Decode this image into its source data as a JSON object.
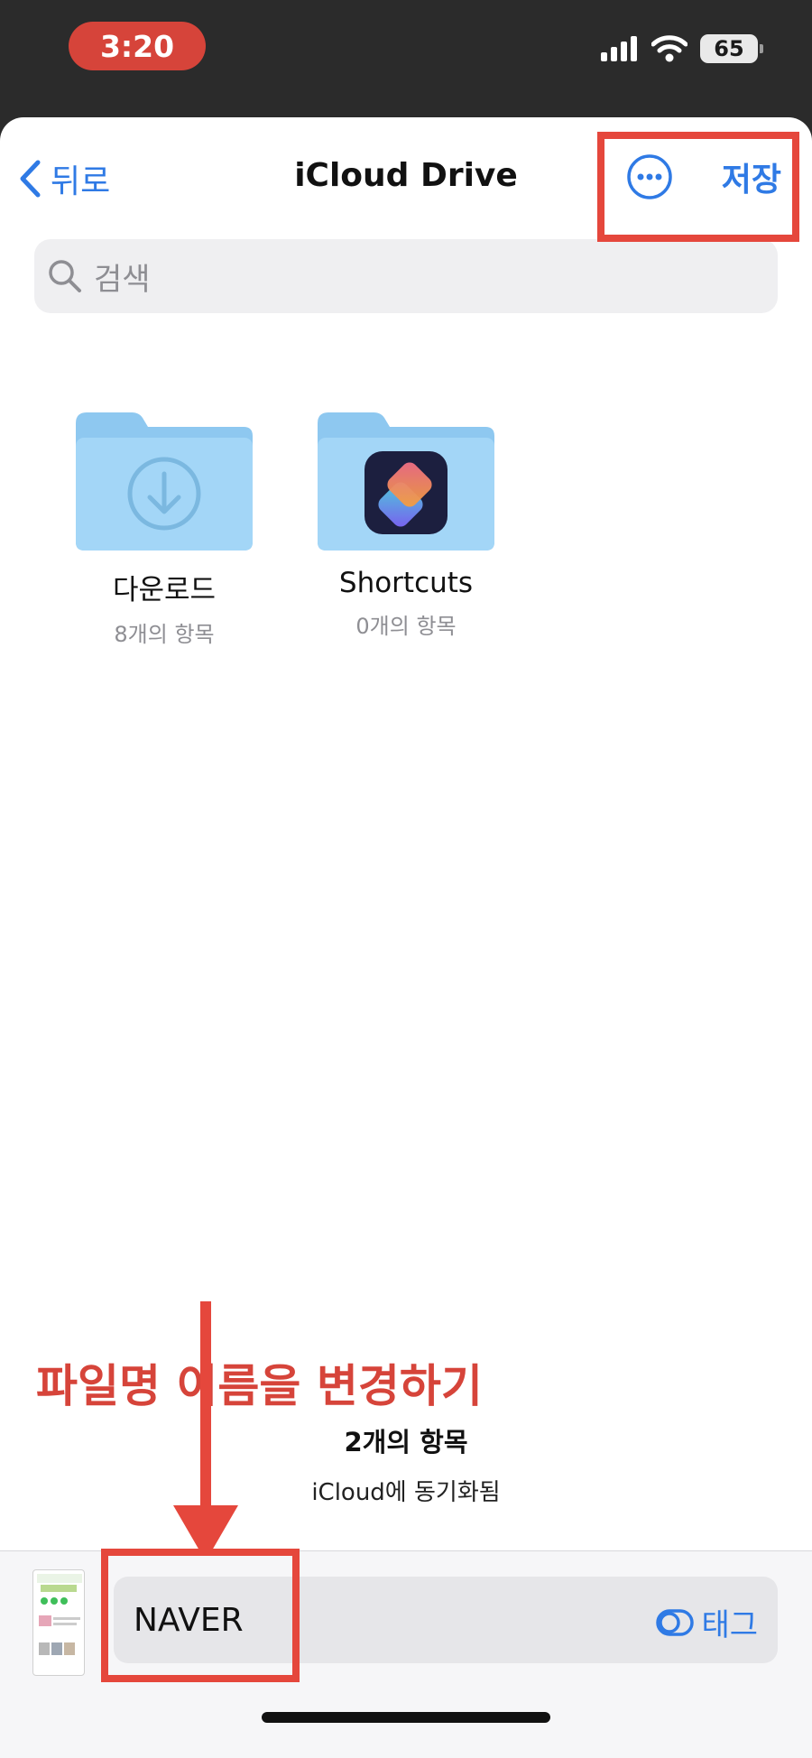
{
  "status_bar": {
    "time": "3:20",
    "battery": "65"
  },
  "nav": {
    "back_label": "뒤로",
    "title": "iCloud Drive",
    "save_label": "저장"
  },
  "search": {
    "placeholder": "검색"
  },
  "folders": [
    {
      "name": "다운로드",
      "count": "8개의 항목",
      "icon": "download-icon"
    },
    {
      "name": "Shortcuts",
      "count": "0개의 항목",
      "icon": "shortcuts-app-icon"
    }
  ],
  "annotation": {
    "text": "파일명 이름을 변경하기"
  },
  "footer": {
    "item_count": "2개의 항목",
    "sync_status": "iCloud에 동기화됨"
  },
  "file": {
    "name": "NAVER",
    "tag_label": "태그"
  },
  "colors": {
    "accent": "#2f7ae5",
    "annotation_red": "#d6443a",
    "folder_blue": "#9dd3f5"
  }
}
